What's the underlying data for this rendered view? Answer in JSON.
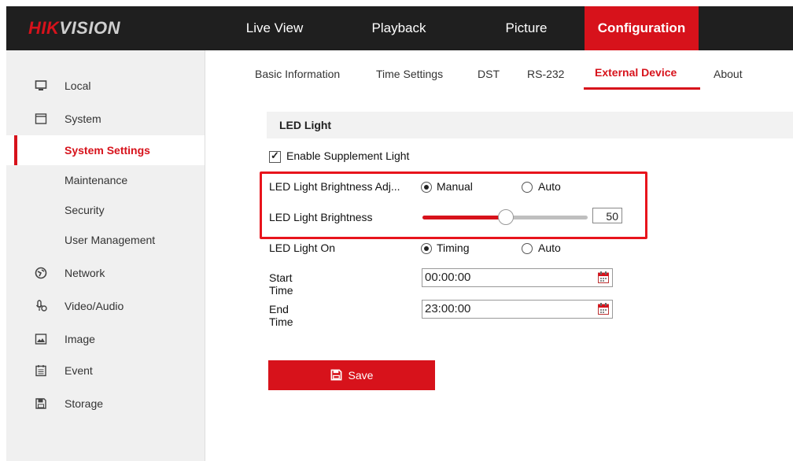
{
  "brand": {
    "logo_red": "HIK",
    "logo_gray": "VISION"
  },
  "nav": [
    {
      "label": "Live View"
    },
    {
      "label": "Playback"
    },
    {
      "label": "Picture"
    },
    {
      "label": "Configuration",
      "active": true
    }
  ],
  "sidebar": {
    "items": [
      {
        "label": "Local",
        "icon": "monitor-icon"
      },
      {
        "label": "System",
        "icon": "system-icon"
      },
      {
        "label": "System Settings",
        "active": true
      },
      {
        "label": "Maintenance"
      },
      {
        "label": "Security"
      },
      {
        "label": "User Management"
      },
      {
        "label": "Network",
        "icon": "globe-icon"
      },
      {
        "label": "Video/Audio",
        "icon": "microphone-icon"
      },
      {
        "label": "Image",
        "icon": "image-icon"
      },
      {
        "label": "Event",
        "icon": "calendar-icon"
      },
      {
        "label": "Storage",
        "icon": "disk-icon"
      }
    ]
  },
  "tabs": [
    {
      "label": "Basic Information"
    },
    {
      "label": "Time Settings"
    },
    {
      "label": "DST"
    },
    {
      "label": "RS-232"
    },
    {
      "label": "External Device",
      "active": true
    },
    {
      "label": "About"
    }
  ],
  "led": {
    "section_title": "LED Light",
    "enable_label": "Enable Supplement Light",
    "enable_checked": true,
    "brightness_adj_label": "LED Light Brightness Adj...",
    "brightness_adj_options": [
      "Manual",
      "Auto"
    ],
    "brightness_adj_selected": "Manual",
    "brightness_label": "LED Light Brightness",
    "brightness_value": "50",
    "brightness_fraction": 0.5,
    "light_on_label": "LED Light On",
    "light_on_options": [
      "Timing",
      "Auto"
    ],
    "light_on_selected": "Timing",
    "start_label": "Start Time",
    "start_value": "00:00:00",
    "end_label": "End Time",
    "end_value": "23:00:00"
  },
  "save_label": "Save",
  "colors": {
    "accent": "#d7121b",
    "topbar": "#1f1f1f",
    "sidebar": "#f0f0f0"
  }
}
